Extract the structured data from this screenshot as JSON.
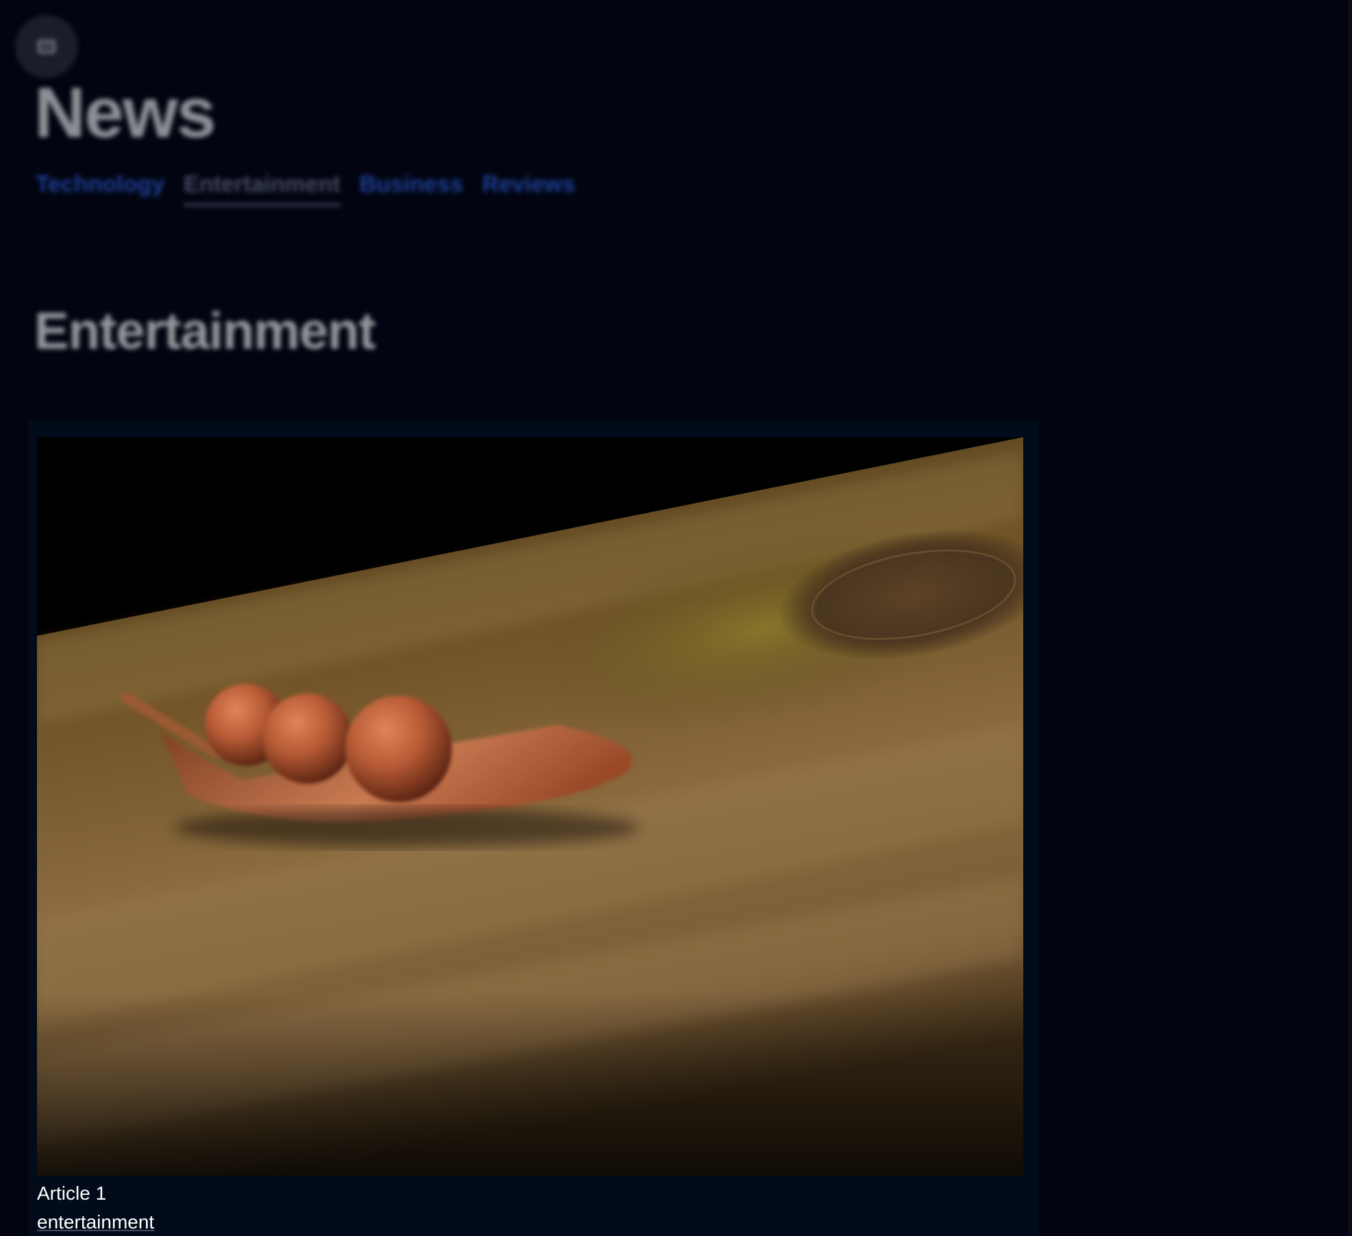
{
  "header": {
    "icon": "menu-icon",
    "title": "News"
  },
  "tabs": [
    {
      "label": "Technology",
      "active": false
    },
    {
      "label": "Entertainment",
      "active": true
    },
    {
      "label": "Business",
      "active": false
    },
    {
      "label": "Reviews",
      "active": false
    }
  ],
  "section": {
    "title": "Entertainment"
  },
  "article": {
    "title": "Article 1",
    "category": "entertainment",
    "image": "seeds-on-leaf-photo"
  },
  "colors": {
    "background": "#020511",
    "tab_link": "#1d3f96",
    "card_background": "#010b1a",
    "text": "#ffffff"
  }
}
